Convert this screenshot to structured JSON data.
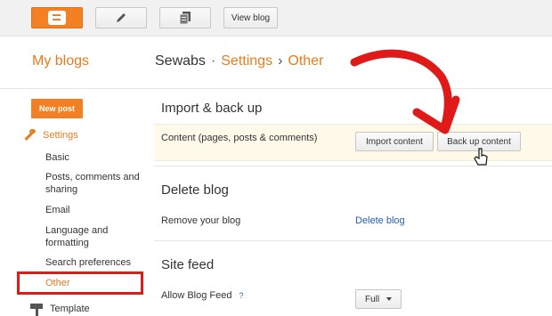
{
  "topbar": {
    "view_blog_label": "View blog"
  },
  "header": {
    "my_blogs": "My blogs",
    "breadcrumb": {
      "blog": "Sewabs",
      "sep1": "·",
      "section": "Settings",
      "sep2": "›",
      "page": "Other"
    }
  },
  "sidebar": {
    "new_post": "New post",
    "settings": "Settings",
    "items": [
      {
        "label": "Basic"
      },
      {
        "label": "Posts, comments and sharing"
      },
      {
        "label": "Email"
      },
      {
        "label": "Language and formatting"
      },
      {
        "label": "Search preferences"
      },
      {
        "label": "Other"
      }
    ],
    "template": "Template"
  },
  "main": {
    "import_backup": {
      "title": "Import & back up",
      "content_label": "Content (pages, posts & comments)",
      "import_button": "Import content",
      "backup_button": "Back up content"
    },
    "delete_blog": {
      "title": "Delete blog",
      "remove_label": "Remove your blog",
      "delete_link": "Delete blog"
    },
    "site_feed": {
      "title": "Site feed",
      "allow_label": "Allow Blog Feed",
      "help": "?",
      "select_value": "Full"
    }
  },
  "colors": {
    "accent": "#f48024",
    "link": "#1f5fb5",
    "highlight": "#e01919"
  }
}
